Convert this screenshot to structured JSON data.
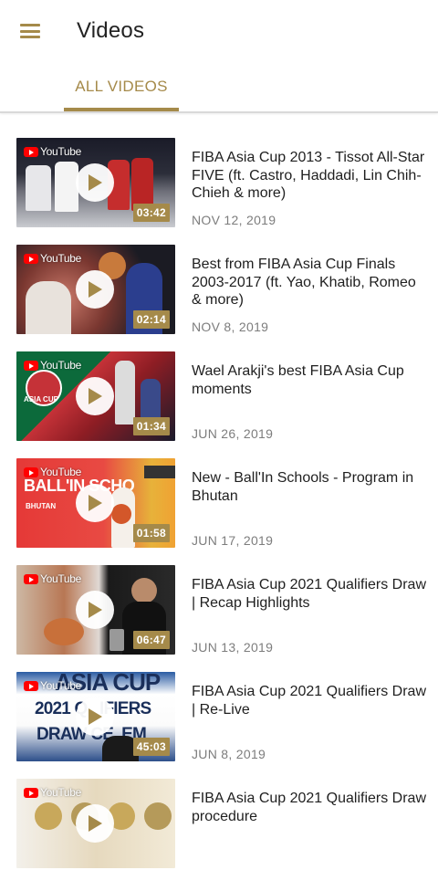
{
  "header": {
    "title": "Videos",
    "menu_icon": "hamburger-menu-icon"
  },
  "tabs": [
    {
      "label": "ALL VIDEOS",
      "selected": true
    }
  ],
  "colors": {
    "accent": "#a58a4a",
    "date_text": "#7d7d7d"
  },
  "videos": [
    {
      "title": "FIBA Asia Cup 2013 - Tissot All-Star FIVE (ft. Castro, Haddadi, Lin Chih-Chieh & more)",
      "date": "NOV 12, 2019",
      "duration": "03:42",
      "source": "YouTube"
    },
    {
      "title": "Best from FIBA Asia Cup Finals 2003-2017 (ft. Yao, Khatib, Romeo & more)",
      "date": "NOV 8, 2019",
      "duration": "02:14",
      "source": "YouTube"
    },
    {
      "title": "Wael Arakji's best FIBA Asia Cup moments",
      "date": "JUN 26, 2019",
      "duration": "01:34",
      "source": "YouTube"
    },
    {
      "title": "New - Ball'In Schools - Program in Bhutan",
      "date": "JUN 17, 2019",
      "duration": "01:58",
      "source": "YouTube"
    },
    {
      "title": "FIBA Asia Cup 2021 Qualifiers Draw | Recap Highlights",
      "date": "JUN 13, 2019",
      "duration": "06:47",
      "source": "YouTube"
    },
    {
      "title": "FIBA Asia Cup 2021 Qualifiers Draw | Re-Live",
      "date": "JUN 8, 2019",
      "duration": "45:03",
      "source": "YouTube"
    },
    {
      "title": "FIBA Asia Cup 2021 Qualifiers Draw procedure",
      "date": "",
      "duration": "",
      "source": "YouTube"
    }
  ],
  "thumb_text": {
    "t3_logo": "ASIA CUP",
    "t4_banner": "BALL'IN SCHO",
    "t4_sub": "BHUTAN",
    "t6_line1": "ASIA CUP",
    "t6_line2": "2021 Q   IFIERS",
    "t6_line3": "DRAW CE  EM"
  }
}
